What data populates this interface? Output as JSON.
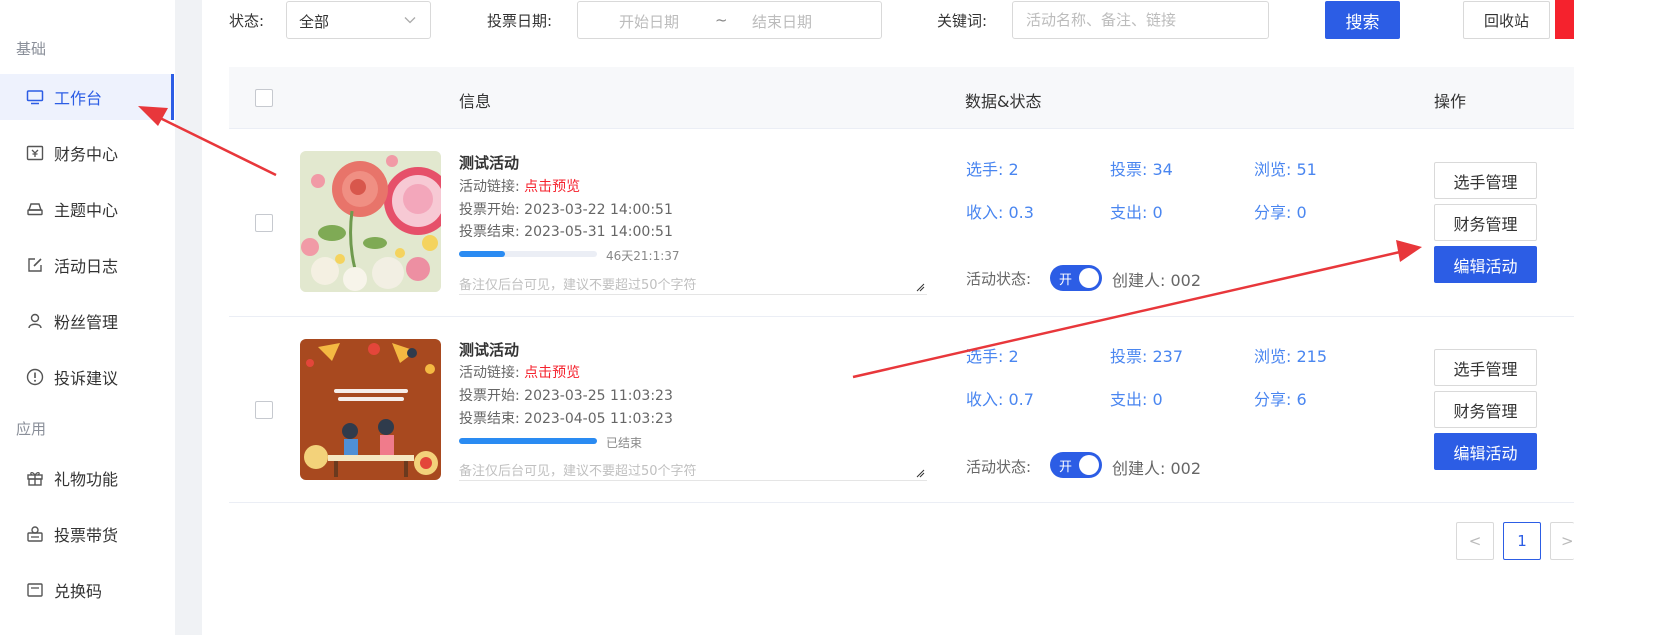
{
  "sidebar": {
    "section_basic": "基础",
    "section_apps": "应用",
    "items": [
      {
        "label": "工作台",
        "icon": "monitor-icon"
      },
      {
        "label": "财务中心",
        "icon": "finance-icon"
      },
      {
        "label": "主题中心",
        "icon": "theme-icon"
      },
      {
        "label": "活动日志",
        "icon": "edit-log-icon"
      },
      {
        "label": "粉丝管理",
        "icon": "user-icon"
      },
      {
        "label": "投诉建议",
        "icon": "alert-icon"
      },
      {
        "label": "礼物功能",
        "icon": "gift-icon"
      },
      {
        "label": "投票带货",
        "icon": "shop-icon"
      },
      {
        "label": "兑换码",
        "icon": "ticket-icon"
      }
    ]
  },
  "filters": {
    "status_label": "状态:",
    "status_value": "全部",
    "date_label": "投票日期:",
    "date_start_placeholder": "开始日期",
    "date_sep": "~",
    "date_end_placeholder": "结束日期",
    "keyword_label": "关键词:",
    "keyword_placeholder": "活动名称、备注、链接",
    "search_button": "搜索",
    "recycle_button": "回收站"
  },
  "table": {
    "columns": {
      "info": "信息",
      "data_status": "数据&状态",
      "actions": "操作"
    },
    "rows": [
      {
        "title": "测试活动",
        "link_label": "活动链接: ",
        "link_text": "点击预览",
        "start": "投票开始: 2023-03-22 14:00:51",
        "end": "投票结束: 2023-05-31 14:00:51",
        "progress": 0.33,
        "progress_text": "46天21:1:37",
        "remark_placeholder": "备注仅后台可见，建议不要超过50个字符",
        "players": "选手: 2",
        "votes": "投票: 34",
        "views": "浏览: 51",
        "income": "收入: 0.3",
        "expense": "支出: 0",
        "shares": "分享: 0",
        "status_label": "活动状态:",
        "switch_text": "开",
        "creator": "创建人: 002",
        "btn_players": "选手管理",
        "btn_finance": "财务管理",
        "btn_edit": "编辑活动"
      },
      {
        "title": "测试活动",
        "link_label": "活动链接: ",
        "link_text": "点击预览",
        "start": "投票开始: 2023-03-25 11:03:23",
        "end": "投票结束: 2023-04-05 11:03:23",
        "progress": 1.0,
        "progress_text": "已结束",
        "remark_placeholder": "备注仅后台可见，建议不要超过50个字符",
        "players": "选手: 2",
        "votes": "投票: 237",
        "views": "浏览: 215",
        "income": "收入: 0.7",
        "expense": "支出: 0",
        "shares": "分享: 6",
        "status_label": "活动状态:",
        "switch_text": "开",
        "creator": "创建人: 002",
        "btn_players": "选手管理",
        "btn_finance": "财务管理",
        "btn_edit": "编辑活动"
      }
    ]
  },
  "pagination": {
    "prev": "<",
    "current": "1",
    "next": ">"
  },
  "colors": {
    "primary": "#2c5de5",
    "annotation": "#e8373b",
    "link": "#f5222d"
  }
}
